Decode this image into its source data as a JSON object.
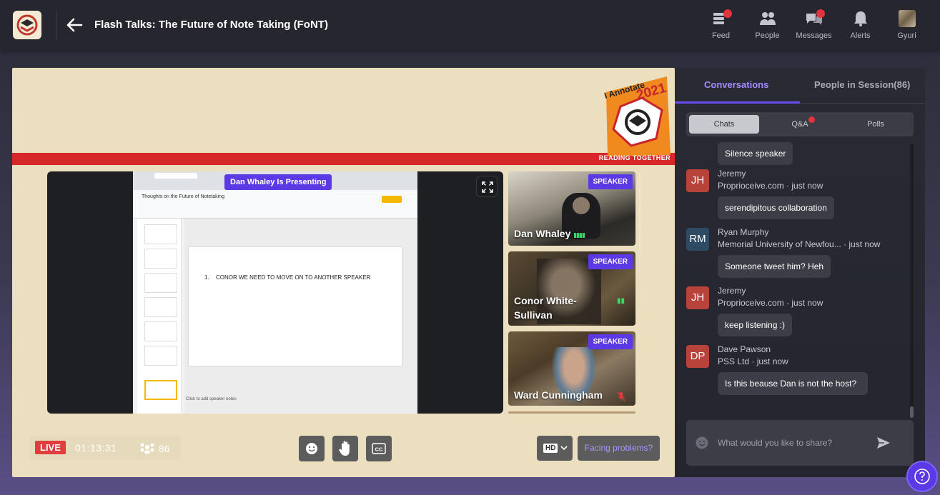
{
  "app": {
    "event_title": "Flash Talks: The Future of Note Taking (FoNT)"
  },
  "nav": {
    "feed": "Feed",
    "people": "People",
    "messages": "Messages",
    "alerts": "Alerts",
    "profile": "Gyuri"
  },
  "brand": {
    "badge_title": "I Annotate",
    "badge_year": "2021",
    "tagline": "READING TOGETHER"
  },
  "stage": {
    "presenting_badge": "Dan Whaley Is Presenting",
    "slide_text": "CONOR WE NEED TO MOVE ON TO ANOTHER SPEAKER",
    "slide_number": "1.",
    "doc_title": "Thoughts on the Future of Notetaking",
    "speaker_notes_hint": "Click to add speaker notes",
    "speakers": [
      {
        "name": "Dan Whaley",
        "badge": "SPEAKER"
      },
      {
        "name": "Conor White-Sullivan",
        "badge": "SPEAKER"
      },
      {
        "name": "Ward Cunningham",
        "badge": "SPEAKER"
      }
    ]
  },
  "controls": {
    "live": "LIVE",
    "timer": "01:13:31",
    "attendees": "86",
    "quality": "HD",
    "facing_problems": "Facing problems?"
  },
  "panel": {
    "tabs": {
      "conversations": "Conversations",
      "people": "People in Session(86)"
    },
    "subtabs": {
      "chats": "Chats",
      "qa": "Q&A",
      "polls": "Polls"
    },
    "messages": [
      {
        "text": "Silence speaker"
      },
      {
        "initials": "JH",
        "name": "Jeremy",
        "org": "Proprioceive.com",
        "time": "just now",
        "text": "serendipitous collaboration",
        "color": "#b8433a"
      },
      {
        "initials": "RM",
        "name": "Ryan Murphy",
        "org": "Memorial University of Newfou...",
        "time": "just now",
        "text": "Someone tweet him? Heh",
        "color": "#2f4a63"
      },
      {
        "initials": "JH",
        "name": "Jeremy",
        "org": "Proprioceive.com",
        "time": "just now",
        "text": "keep listening :)",
        "color": "#b8433a"
      },
      {
        "initials": "DP",
        "name": "Dave Pawson",
        "org": "PSS Ltd",
        "time": "just now",
        "text": "Is this beause Dan is not the host?",
        "color": "#b8433a"
      }
    ],
    "composer_placeholder": "What would you like to share?"
  },
  "colors": {
    "accent": "#5b3ae6",
    "live": "#e23d3d",
    "stage_bg": "#ecdfc0",
    "brand_red": "#d8272a",
    "brand_orange": "#f08a1f"
  }
}
